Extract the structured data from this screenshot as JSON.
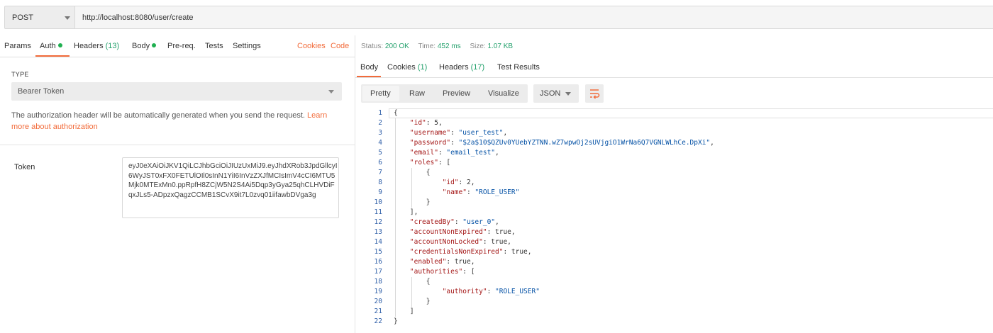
{
  "request": {
    "method": "POST",
    "url": "http://localhost:8080/user/create"
  },
  "left_tabs": {
    "params": "Params",
    "auth": "Auth",
    "headers": "Headers",
    "headers_count": "(13)",
    "body": "Body",
    "prereq": "Pre-req.",
    "tests": "Tests",
    "settings": "Settings",
    "cookies": "Cookies",
    "code": "Code"
  },
  "auth": {
    "type_label": "TYPE",
    "type_value": "Bearer Token",
    "note_text": "The authorization header will be automatically generated when you send the request.",
    "note_link": "Learn more about authorization",
    "token_label": "Token",
    "token_value": "eyJ0eXAiOiJKV1QiLCJhbGciOiJIUzUxMiJ9.eyJhdXRob3JpdGllcyI6WyJST0xFX0FETUlOIl0sInN1YiI6InVzZXJfMCIsImV4cCI6MTU5Mjk0MTExMn0.ppRpfH8ZCjW5N2S4Ai5Dqp3yGya25qhCLHVDiFqxJLs5-ADpzxQagzCCMB1SCvX9it7L0zvq01iifawbDVga3g"
  },
  "status": {
    "status_label": "Status:",
    "status_value": "200 OK",
    "time_label": "Time:",
    "time_value": "452 ms",
    "size_label": "Size:",
    "size_value": "1.07 KB"
  },
  "response_tabs": {
    "body": "Body",
    "cookies": "Cookies",
    "cookies_count": "(1)",
    "headers": "Headers",
    "headers_count": "(17)",
    "test_results": "Test Results"
  },
  "toolbar": {
    "pretty": "Pretty",
    "raw": "Raw",
    "preview": "Preview",
    "visualize": "Visualize",
    "format": "JSON"
  },
  "icons": {
    "method_dropdown": "chevron-down-icon",
    "type_dropdown": "chevron-down-icon",
    "format_dropdown": "chevron-down-icon",
    "wrap": "wrap-lines-icon"
  },
  "colors": {
    "accent": "#f26b3a",
    "success": "#22a06b",
    "json_key": "#a31515",
    "json_string": "#0451a5",
    "line_number": "#2f5fa8"
  },
  "code_lines": [
    "{",
    "    \"id\": 5,",
    "    \"username\": \"user_test\",",
    "    \"password\": \"$2a$10$QZUv0YUebYZTNN.wZ7wpwOj2sUVjgiO1WrNa6Q7VGNLWLhCe.DpXi\",",
    "    \"email\": \"email_test\",",
    "    \"roles\": [",
    "        {",
    "            \"id\": 2,",
    "            \"name\": \"ROLE_USER\"",
    "        }",
    "    ],",
    "    \"createdBy\": \"user_0\",",
    "    \"accountNonExpired\": true,",
    "    \"accountNonLocked\": true,",
    "    \"credentialsNonExpired\": true,",
    "    \"enabled\": true,",
    "    \"authorities\": [",
    "        {",
    "            \"authority\": \"ROLE_USER\"",
    "        }",
    "    ]",
    "}"
  ]
}
